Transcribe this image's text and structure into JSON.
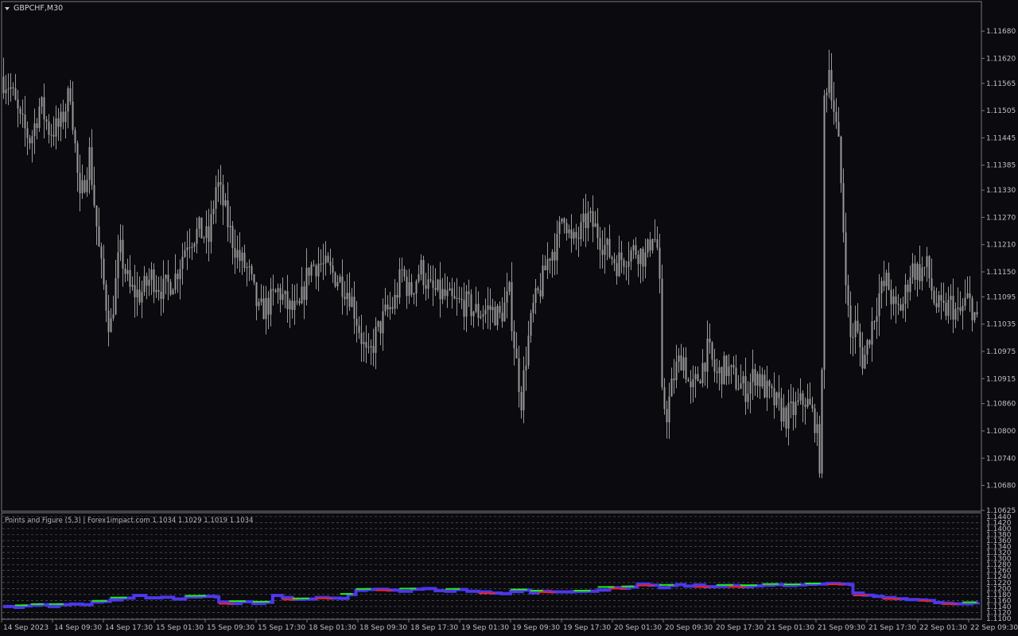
{
  "window": {
    "symbol_label": "GBPCHF,M30",
    "indicator_label": "Points and Figure (5,3) | Forex1impact.com 1.1034 1.1029 1.1019 1.1034"
  },
  "colors": {
    "background": "#0a0a0f",
    "candle": "#9a9a9a",
    "pf_x": "#3a3aff",
    "pf_o": "#d02060",
    "pf_up_line": "#22ee22",
    "pf_down_line": "#ee2222",
    "grid": "#6a6a6a",
    "border": "#7a7a7a"
  },
  "chart_data": [
    {
      "type": "candlestick",
      "title": "GBPCHF,M30",
      "ylim": [
        1.10625,
        1.1171
      ],
      "y_ticks": [
        "1.11680",
        "1.11620",
        "1.11565",
        "1.11505",
        "1.11445",
        "1.11385",
        "1.11330",
        "1.11270",
        "1.11210",
        "1.11150",
        "1.11095",
        "1.11035",
        "1.10975",
        "1.10915",
        "1.10860",
        "1.10800",
        "1.10740",
        "1.10680",
        "1.10625"
      ],
      "x_ticks": [
        "14 Sep 2023",
        "14 Sep 09:30",
        "14 Sep 17:30",
        "15 Sep 01:30",
        "15 Sep 09:30",
        "15 Sep 17:30",
        "18 Sep 01:30",
        "18 Sep 09:30",
        "18 Sep 17:30",
        "19 Sep 01:30",
        "19 Sep 09:30",
        "19 Sep 17:30",
        "20 Sep 01:30",
        "20 Sep 09:30",
        "20 Sep 17:30",
        "21 Sep 01:30",
        "21 Sep 09:30",
        "21 Sep 17:30",
        "22 Sep 01:30",
        "22 Sep 09:30"
      ],
      "close_path": [
        [
          0,
          1.1158
        ],
        [
          12,
          1.1156
        ],
        [
          25,
          1.1148
        ],
        [
          38,
          1.1144
        ],
        [
          50,
          1.1152
        ],
        [
          62,
          1.1146
        ],
        [
          75,
          1.1147
        ],
        [
          88,
          1.1155
        ],
        [
          100,
          1.113
        ],
        [
          112,
          1.1141
        ],
        [
          125,
          1.1118
        ],
        [
          138,
          1.1102
        ],
        [
          150,
          1.112
        ],
        [
          163,
          1.1111
        ],
        [
          176,
          1.111
        ],
        [
          190,
          1.1114
        ],
        [
          205,
          1.1111
        ],
        [
          220,
          1.1114
        ],
        [
          235,
          1.1122
        ],
        [
          250,
          1.1124
        ],
        [
          262,
          1.1122
        ],
        [
          272,
          1.1135
        ],
        [
          280,
          1.113
        ],
        [
          290,
          1.1123
        ],
        [
          300,
          1.1118
        ],
        [
          312,
          1.1115
        ],
        [
          325,
          1.1106
        ],
        [
          338,
          1.1108
        ],
        [
          350,
          1.1111
        ],
        [
          362,
          1.1107
        ],
        [
          375,
          1.1106
        ],
        [
          388,
          1.1116
        ],
        [
          400,
          1.1117
        ],
        [
          415,
          1.1115
        ],
        [
          428,
          1.1113
        ],
        [
          440,
          1.111
        ],
        [
          452,
          1.1102
        ],
        [
          462,
          1.1095
        ],
        [
          472,
          1.1101
        ],
        [
          485,
          1.1106
        ],
        [
          495,
          1.1108
        ],
        [
          505,
          1.1115
        ],
        [
          515,
          1.111
        ],
        [
          528,
          1.1116
        ],
        [
          540,
          1.1111
        ],
        [
          555,
          1.111
        ],
        [
          570,
          1.1108
        ],
        [
          585,
          1.1108
        ],
        [
          600,
          1.1106
        ],
        [
          615,
          1.1107
        ],
        [
          628,
          1.1105
        ],
        [
          640,
          1.111
        ],
        [
          648,
          1.1096
        ],
        [
          655,
          1.1087
        ],
        [
          662,
          1.1098
        ],
        [
          670,
          1.1107
        ],
        [
          680,
          1.1112
        ],
        [
          690,
          1.1119
        ],
        [
          700,
          1.1121
        ],
        [
          708,
          1.1129
        ],
        [
          718,
          1.1121
        ],
        [
          728,
          1.1123
        ],
        [
          738,
          1.1127
        ],
        [
          750,
          1.1124
        ],
        [
          762,
          1.112
        ],
        [
          775,
          1.1117
        ],
        [
          788,
          1.1119
        ],
        [
          800,
          1.112
        ],
        [
          812,
          1.1118
        ],
        [
          820,
          1.1124
        ],
        [
          828,
          1.1119
        ],
        [
          832,
          1.1087
        ],
        [
          838,
          1.1084
        ],
        [
          848,
          1.1093
        ],
        [
          858,
          1.1097
        ],
        [
          868,
          1.1088
        ],
        [
          880,
          1.1093
        ],
        [
          890,
          1.1098
        ],
        [
          900,
          1.1092
        ],
        [
          912,
          1.1094
        ],
        [
          925,
          1.1091
        ],
        [
          938,
          1.1089
        ],
        [
          950,
          1.1093
        ],
        [
          962,
          1.1089
        ],
        [
          975,
          1.1086
        ],
        [
          988,
          1.1083
        ],
        [
          1000,
          1.1085
        ],
        [
          1012,
          1.1087
        ],
        [
          1025,
          1.1082
        ],
        [
          1032,
          1.107
        ],
        [
          1036,
          1.1153
        ],
        [
          1042,
          1.116
        ],
        [
          1048,
          1.1151
        ],
        [
          1055,
          1.1141
        ],
        [
          1062,
          1.1118
        ],
        [
          1068,
          1.11
        ],
        [
          1075,
          1.1103
        ],
        [
          1085,
          1.1095
        ],
        [
          1095,
          1.1103
        ],
        [
          1105,
          1.111
        ],
        [
          1115,
          1.1113
        ],
        [
          1125,
          1.1106
        ],
        [
          1135,
          1.1108
        ],
        [
          1145,
          1.1116
        ],
        [
          1155,
          1.1115
        ],
        [
          1165,
          1.1116
        ],
        [
          1175,
          1.1108
        ],
        [
          1185,
          1.1106
        ],
        [
          1195,
          1.1108
        ],
        [
          1205,
          1.1105
        ],
        [
          1215,
          1.1109
        ],
        [
          1223,
          1.1107
        ],
        [
          1230,
          1.1102
        ]
      ]
    },
    {
      "type": "line",
      "title": "Points and Figure (5,3)",
      "ylim": [
        1.11,
        1.1445
      ],
      "y_ticks": [
        "1.1440",
        "1.1420",
        "1.1400",
        "1.1380",
        "1.1360",
        "1.1340",
        "1.1320",
        "1.1300",
        "1.1280",
        "1.1260",
        "1.1240",
        "1.1220",
        "1.1200",
        "1.1180",
        "1.1160",
        "1.1140",
        "1.1120",
        "1.1100"
      ],
      "series": [
        {
          "name": "",
          "points": [
            [
              0,
              1.114
            ],
            [
              15,
              1.1137
            ],
            [
              25,
              1.1142
            ],
            [
              35,
              1.1144
            ],
            [
              45,
              1.1146
            ],
            [
              58,
              1.114
            ],
            [
              70,
              1.1146
            ],
            [
              85,
              1.1148
            ],
            [
              100,
              1.1146
            ],
            [
              112,
              1.1155
            ],
            [
              125,
              1.1157
            ],
            [
              135,
              1.1162
            ],
            [
              150,
              1.1168
            ],
            [
              165,
              1.1177
            ],
            [
              180,
              1.1169
            ],
            [
              200,
              1.1171
            ],
            [
              215,
              1.1165
            ],
            [
              230,
              1.1172
            ],
            [
              250,
              1.1174
            ],
            [
              268,
              1.1172
            ],
            [
              272,
              1.1155
            ],
            [
              285,
              1.115
            ],
            [
              300,
              1.1156
            ],
            [
              315,
              1.115
            ],
            [
              330,
              1.1154
            ],
            [
              340,
              1.1177
            ],
            [
              352,
              1.117
            ],
            [
              365,
              1.1164
            ],
            [
              380,
              1.1165
            ],
            [
              395,
              1.117
            ],
            [
              410,
              1.1168
            ],
            [
              425,
              1.1167
            ],
            [
              435,
              1.118
            ],
            [
              445,
              1.1194
            ],
            [
              458,
              1.1197
            ],
            [
              470,
              1.1198
            ],
            [
              485,
              1.1195
            ],
            [
              500,
              1.1191
            ],
            [
              515,
              1.1198
            ],
            [
              530,
              1.12
            ],
            [
              545,
              1.1193
            ],
            [
              558,
              1.1191
            ],
            [
              570,
              1.1197
            ],
            [
              585,
              1.1191
            ],
            [
              600,
              1.1189
            ],
            [
              615,
              1.1185
            ],
            [
              628,
              1.1183
            ],
            [
              640,
              1.119
            ],
            [
              655,
              1.1195
            ],
            [
              665,
              1.1186
            ],
            [
              675,
              1.1191
            ],
            [
              690,
              1.1189
            ],
            [
              705,
              1.1189
            ],
            [
              720,
              1.119
            ],
            [
              735,
              1.1191
            ],
            [
              750,
              1.1195
            ],
            [
              765,
              1.1203
            ],
            [
              780,
              1.1201
            ],
            [
              790,
              1.1205
            ],
            [
              800,
              1.1215
            ],
            [
              815,
              1.1211
            ],
            [
              828,
              1.1203
            ],
            [
              840,
              1.121
            ],
            [
              850,
              1.1213
            ],
            [
              860,
              1.1208
            ],
            [
              872,
              1.1212
            ],
            [
              885,
              1.1206
            ],
            [
              900,
              1.1207
            ],
            [
              915,
              1.121
            ],
            [
              930,
              1.1206
            ],
            [
              945,
              1.1209
            ],
            [
              958,
              1.1211
            ],
            [
              972,
              1.1213
            ],
            [
              985,
              1.121
            ],
            [
              1000,
              1.1212
            ],
            [
              1012,
              1.1214
            ],
            [
              1025,
              1.1215
            ],
            [
              1040,
              1.1217
            ],
            [
              1055,
              1.1215
            ],
            [
              1068,
              1.1213
            ],
            [
              1072,
              1.1185
            ],
            [
              1085,
              1.1178
            ],
            [
              1098,
              1.1174
            ],
            [
              1110,
              1.117
            ],
            [
              1125,
              1.1166
            ],
            [
              1140,
              1.1163
            ],
            [
              1155,
              1.1162
            ],
            [
              1165,
              1.116
            ],
            [
              1175,
              1.1153
            ],
            [
              1185,
              1.1151
            ],
            [
              1198,
              1.1149
            ],
            [
              1210,
              1.1149
            ],
            [
              1222,
              1.1152
            ],
            [
              1230,
              1.1154
            ]
          ]
        }
      ]
    }
  ]
}
